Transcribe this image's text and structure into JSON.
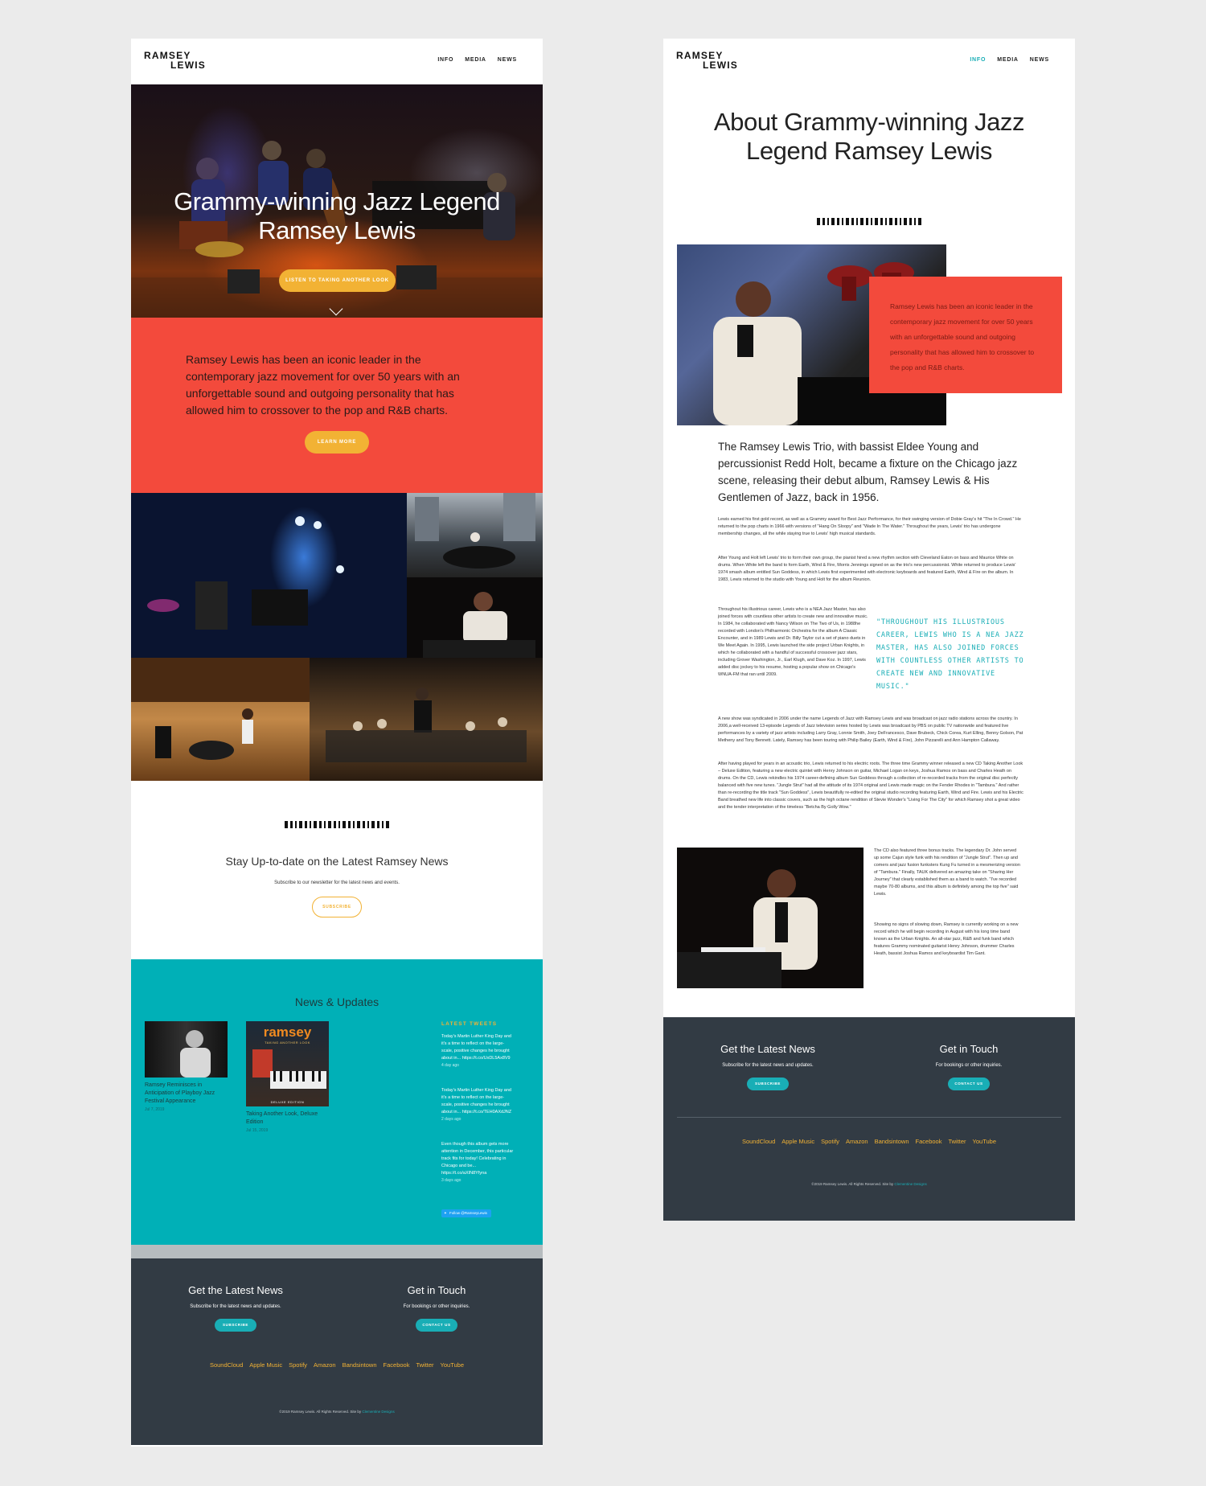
{
  "site": {
    "logo_line1": "RAMSEY",
    "logo_line2": "LEWIS",
    "nav": [
      "INFO",
      "MEDIA",
      "NEWS"
    ]
  },
  "home": {
    "hero_title": "Grammy-winning Jazz Legend Ramsey Lewis",
    "hero_button": "LISTEN TO TAKING ANOTHER LOOK",
    "intro": "Ramsey Lewis has been an iconic leader in the contemporary jazz movement for over 50 years with an unforgettable sound and outgoing personality that has allowed him to crossover to the pop and R&B charts.",
    "learn_more": "LEARN MORE",
    "newsletter_title": "Stay Up-to-date on the Latest Ramsey News",
    "newsletter_text": "Subscribe to our newsletter for the latest news and events.",
    "subscribe": "SUBSCRIBE",
    "news_title": "News & Updates",
    "news_items": [
      {
        "title": "Ramsey Reminisces in Anticipation of Playboy Jazz Festival Appearance",
        "date": "Jul 7, 2019"
      },
      {
        "title": "Taking Another Look, Deluxe Edition",
        "date": "Jul 15, 2019"
      }
    ],
    "album_cover_title": "ramsey",
    "album_cover_sub": "TAKING ANOTHER LOOK",
    "album_cover_badge": "DELUXE EDITION",
    "tweets_heading": "LATEST TWEETS",
    "tweets": [
      {
        "text": "Today's Martin Luther King Day and it's a time to reflect on the large-scale, positive changes he brought about in...",
        "link": "https://t.co/UxDL5Ax8V9",
        "date": "4 day ago"
      },
      {
        "text": "Today's Martin Luther King Day and it's a time to reflect on the large-scale, positive changes he brought about in...",
        "link": "https://t.co/TEH0AXdJNZ",
        "date": "2 days ago"
      },
      {
        "text": "Even though this album gets more attention in December, this particular track fits for today! Celebrating in Chicago and be...",
        "link": "https://t.co/aXIN8Yfyna",
        "date": "3 days ago"
      }
    ],
    "follow": "Follow @RamseyLewis"
  },
  "footer": {
    "news_title": "Get the Latest News",
    "news_text": "Subscribe for the latest news and updates.",
    "news_button": "SUBSCRIBE",
    "contact_title": "Get in Touch",
    "contact_text": "For bookings or other inquiries.",
    "contact_button": "CONTACT US",
    "links": [
      "SoundCloud",
      "Apple Music",
      "Spotify",
      "Amazon",
      "Bandsintown",
      "Facebook",
      "Twitter",
      "YouTube"
    ],
    "copyright": "©2019 Ramsey Lewis. All Rights Reserved. Site by",
    "credit": "Clementine Designs"
  },
  "about": {
    "title": "About Grammy-winning Jazz Legend Ramsey Lewis",
    "red_box": "Ramsey Lewis has been an iconic leader in the contemporary jazz movement for over 50 years with an unforgettable sound and outgoing personality that has allowed him to crossover to the pop and R&B charts.",
    "lead": "The Ramsey Lewis Trio, with bassist Eldee Young and percussionist Redd Holt, became a fixture on the Chicago jazz scene, releasing their debut album, Ramsey Lewis & His Gentlemen of Jazz, back in 1956.",
    "p1": "Lewis earned his first gold record, as well as a Grammy award for Best Jazz Performance, for their swinging version of Dobie Gray's hit \"The In Crowd.\" He returned to the pop charts in 1966 with versions of \"Hang On Sloopy\" and \"Wade In The Water.\" Throughout the years, Lewis' trio has undergone membership changes, all the while staying true to Lewis' high musical standards.",
    "p2": "After Young and Holt left Lewis' trio to form their own group, the pianist hired a new rhythm section with Cleveland Eaton on bass and Maurice White on drums. When White left the band to form Earth, Wind & Fire, Morris Jennings signed on as the trio's new percussionist. White returned to produce Lewis' 1974 smash album entitled Sun Goddess, in which Lewis first experimented with electronic keyboards and featured Earth, Wind & Fire on the album. In 1983, Lewis returned to the studio with Young and Holt for the album Reunion.",
    "p3": "Throughout his illustrious career, Lewis who is a NEA Jazz Master, has also joined forces with countless other artists to create new and innovative music. In 1984, he collaborated with Nancy Wilson on The Two of Us, in 1988he recorded with London's Philharmonic Orchestra for the album A Classic Encounter, and in 1989 Lewis and Dr. Billy Taylor cut a set of piano duets in We Meet Again. In 1995, Lewis launched the side project Urban Knights, in which he collaborated with a handful of successful crossover jazz stars, including Grover Washington, Jr., Earl Klugh, and Dave Koz. In 1997, Lewis added disc jockey to his resume, hosting a popular show on Chicago's WNUA-FM that ran until 2009.",
    "quote": "\"THROUGHOUT HIS ILLUSTRIOUS CAREER, LEWIS WHO IS A NEA JAZZ MASTER, HAS ALSO JOINED FORCES WITH COUNTLESS OTHER ARTISTS TO CREATE NEW AND INNOVATIVE MUSIC.\"",
    "p4": "A new show was syndicated in 2006 under the name Legends of Jazz with Ramsey Lewis and was broadcast on jazz radio stations across the country. In 2006,a well-received 13-episode Legends of Jazz television series hosted by Lewis was broadcast by PBS on public TV nationwide and featured live performances by a variety of jazz artists including Larry Gray, Lonnie Smith, Joey DeFrancesco, Dave Brubeck, Chick Corea, Kurt Elling, Benny Golson, Pat Metheny and Tony Bennett. Lately, Ramsey has been touring with Philip Bailey (Earth, Wind & Fire), John Pizzarelli and Ann Hampton Callaway.",
    "p5": "After having played for years in an acoustic trio, Lewis returned to his electric roots. The three time Grammy winner released a new CD Taking Another Look – Deluxe Edition, featuring a new electric quintet with Henry Johnson on guitar, Michael Logan on keys, Joshua Ramos on bass and Charles Heath on drums. On the CD, Lewis rekindles his 1974 career-defining album Sun Goddess through a collection of re-recorded tracks from the original disc perfectly balanced with five new tunes. \"Jungle Strut\" had all the attitude of its 1974 original and Lewis made magic on the Fender Rhodes in \"Tambura.\" And rather than re-recording the title track \"Sun Goddess\", Lewis beautifully re-edited the original studio recording featuring Earth, Wind and Fire. Lewis and his Electric Band breathed new life into classic covers, such as the high octane rendition of Stevie Wonder's \"Living For The City\" for which Ramsey shot a great video and the tender interpretation of the timeless \"Betcha By Golly Wow.\"",
    "p6": "The CD also featured three bonus tracks. The legendary Dr. John served up some Cajun style funk with his rendition of \"Jungle Strut\". Then up and comers and jazz fusion funksters Kung Fu turned in a mesmerizing version of \"Tambura.\" Finally, TAUK delivered an amazing take on \"Sharing Her Journey\" that clearly established them as a band to watch. \"I've recorded maybe 70-80 albums, and this album is definitely among the top five\" said Lewis.",
    "p7": "Showing no signs of slowing down, Ramsey is currently working on a new record which he will begin recording in August with his long time band known as the Urban Knights. An all-star jazz, R&B and funk band which features Grammy nominated guitarist Henry Johnson, drummer Charles Heath, bassist Joshua Ramos and keyboardist Tim Gant."
  },
  "colors": {
    "red": "#f34a3c",
    "teal": "#00b0b7",
    "gold": "#f2b234",
    "footer": "#323b44"
  }
}
